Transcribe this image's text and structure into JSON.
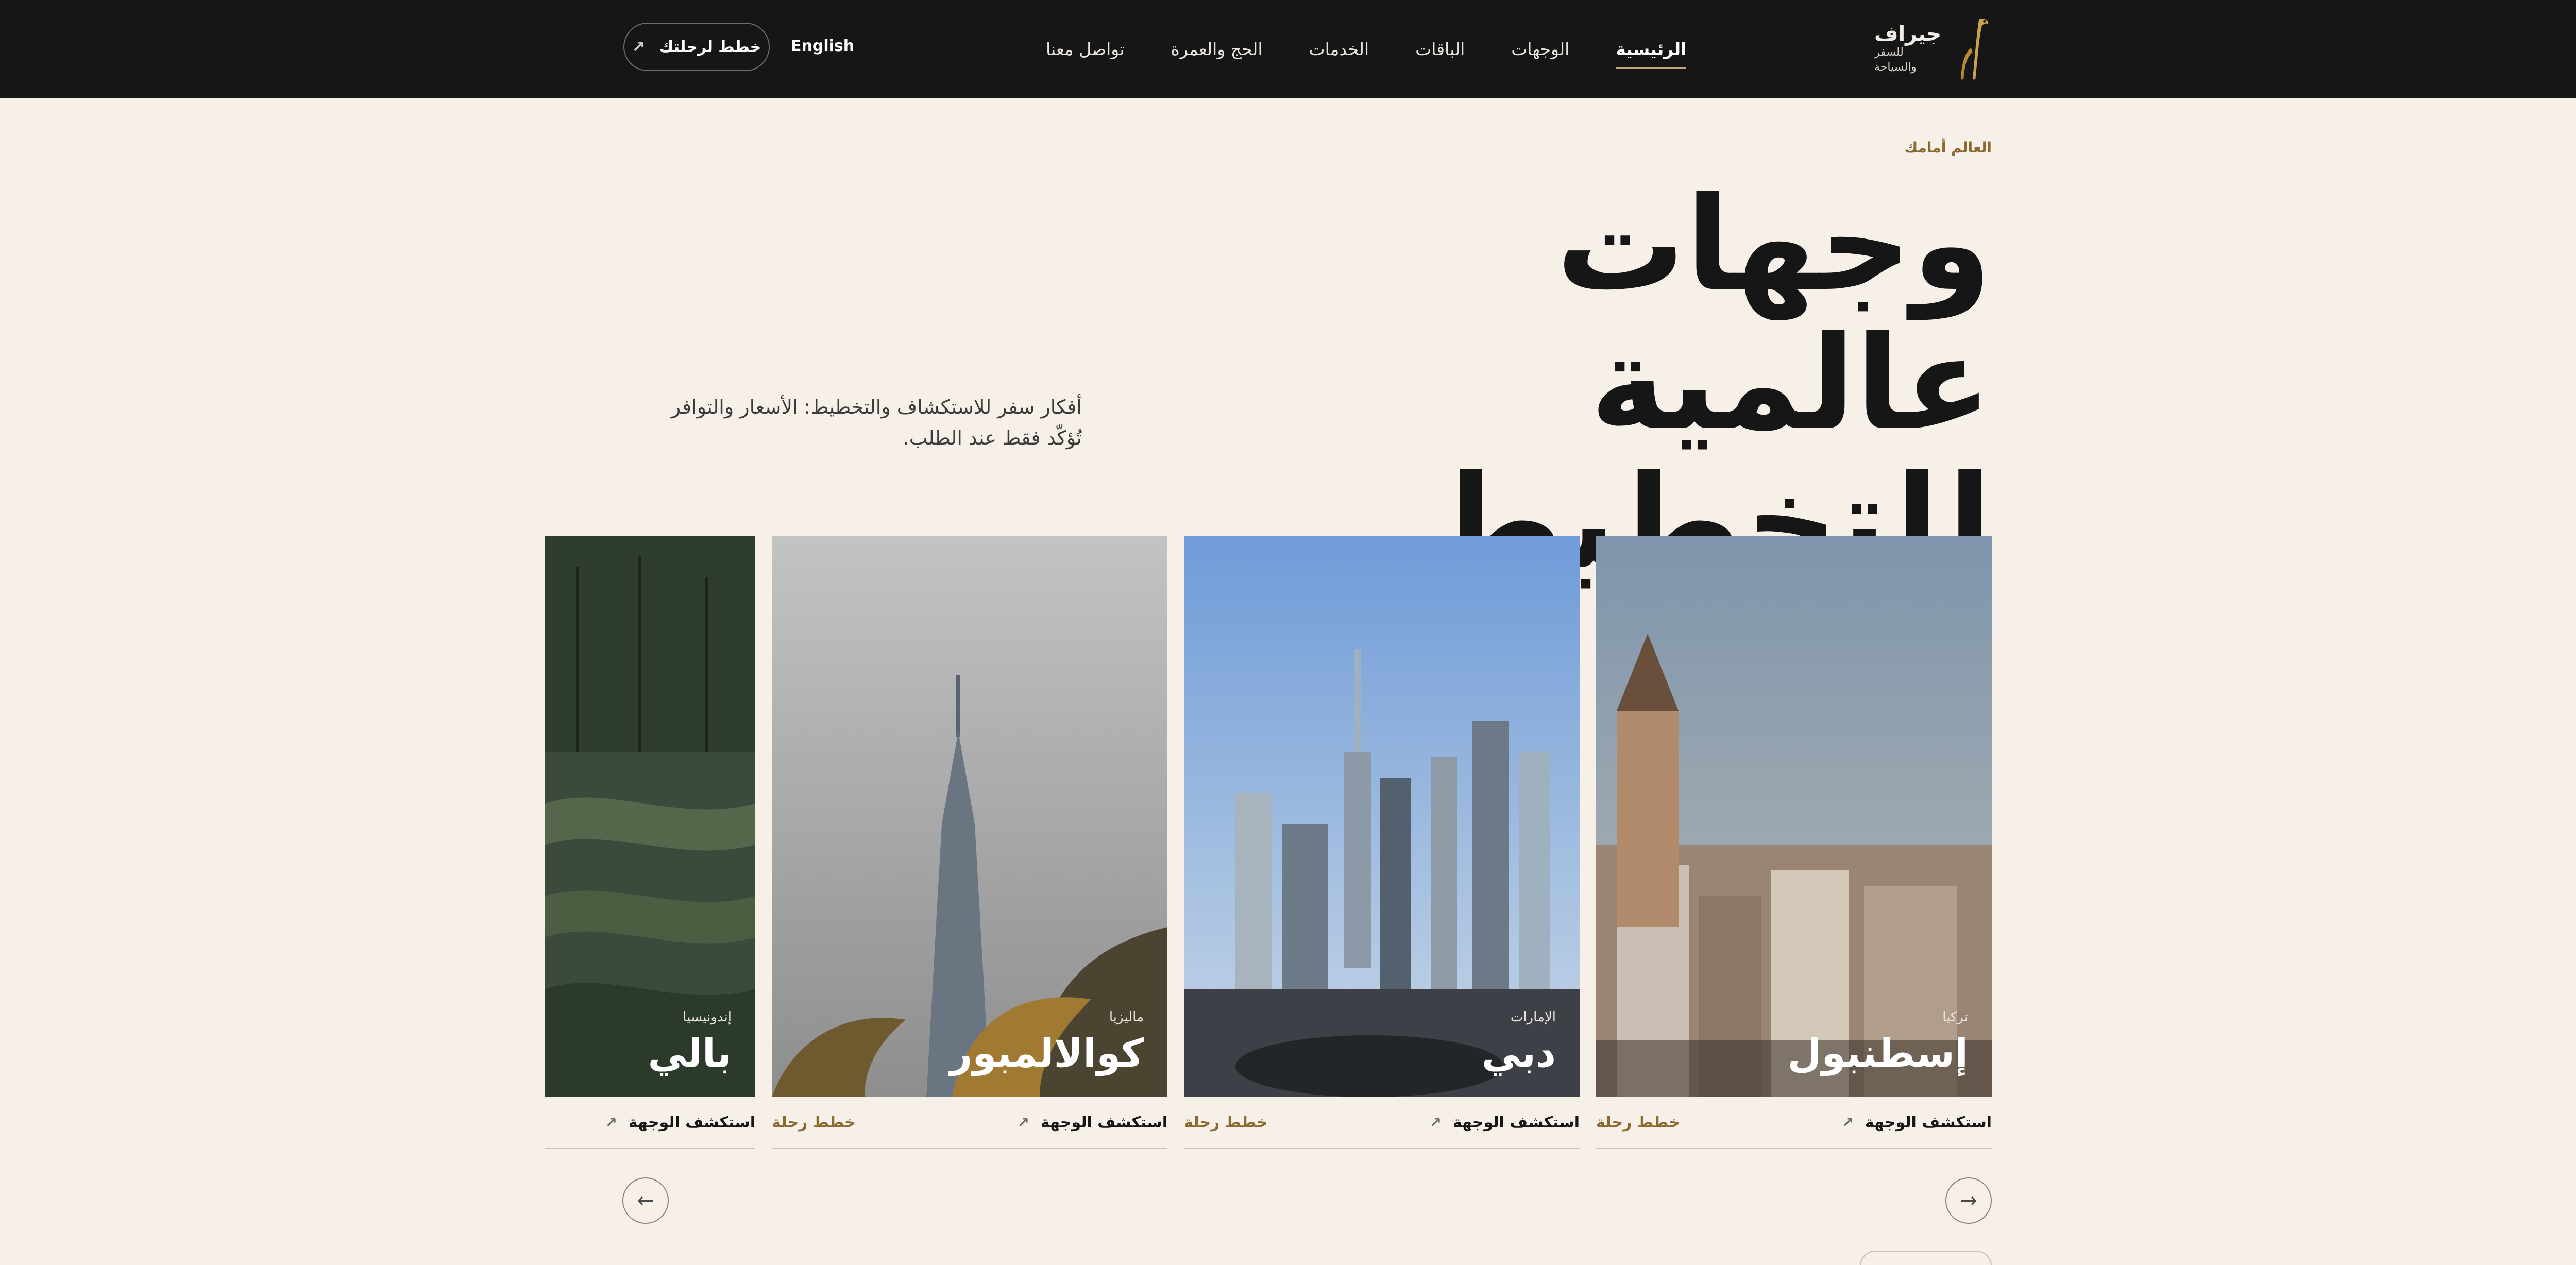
{
  "header": {
    "brand_name": "جيراف",
    "brand_tagline": "للسفر والسياحة",
    "nav": [
      {
        "label": "الرئيسية",
        "active": true
      },
      {
        "label": "الوجهات"
      },
      {
        "label": "الباقات"
      },
      {
        "label": "الخدمات"
      },
      {
        "label": "الحج والعمرة"
      },
      {
        "label": "تواصل معنا"
      }
    ],
    "language_label": "English",
    "plan_button_label": "خطط لرحلتك",
    "colors": {
      "background": "#161616",
      "accent": "#c0a97a"
    }
  },
  "hero": {
    "kicker": "العالم أمامك",
    "title_line1": "وجهات عالمية",
    "title_line2": "للتخطيط",
    "description_line1": "أفكار سفر للاستكشاف والتخطيط: الأسعار والتوافر",
    "description_line2": "تُؤكّد فقط عند الطلب."
  },
  "destinations": [
    {
      "country": "تركيا",
      "city": "إسطنبول",
      "explore_label": "استكشف الوجهة",
      "plan_label": "خطط رحلة"
    },
    {
      "country": "الإمارات",
      "city": "دبي",
      "explore_label": "استكشف الوجهة",
      "plan_label": "خطط رحلة"
    },
    {
      "country": "ماليزيا",
      "city": "كوالالمبور",
      "explore_label": "استكشف الوجهة",
      "plan_label": "خطط رحلة"
    },
    {
      "country": "إندونيسيا",
      "city": "بالي",
      "explore_label": "استكشف الوجهة"
    }
  ],
  "carousel": {
    "prev_icon": "arrow-right-icon",
    "next_icon": "arrow-left-icon",
    "prev_glyph": "→",
    "next_glyph": "←"
  },
  "colors": {
    "page_bg": "#f6f0e9",
    "gold": "#8a6a2f"
  }
}
